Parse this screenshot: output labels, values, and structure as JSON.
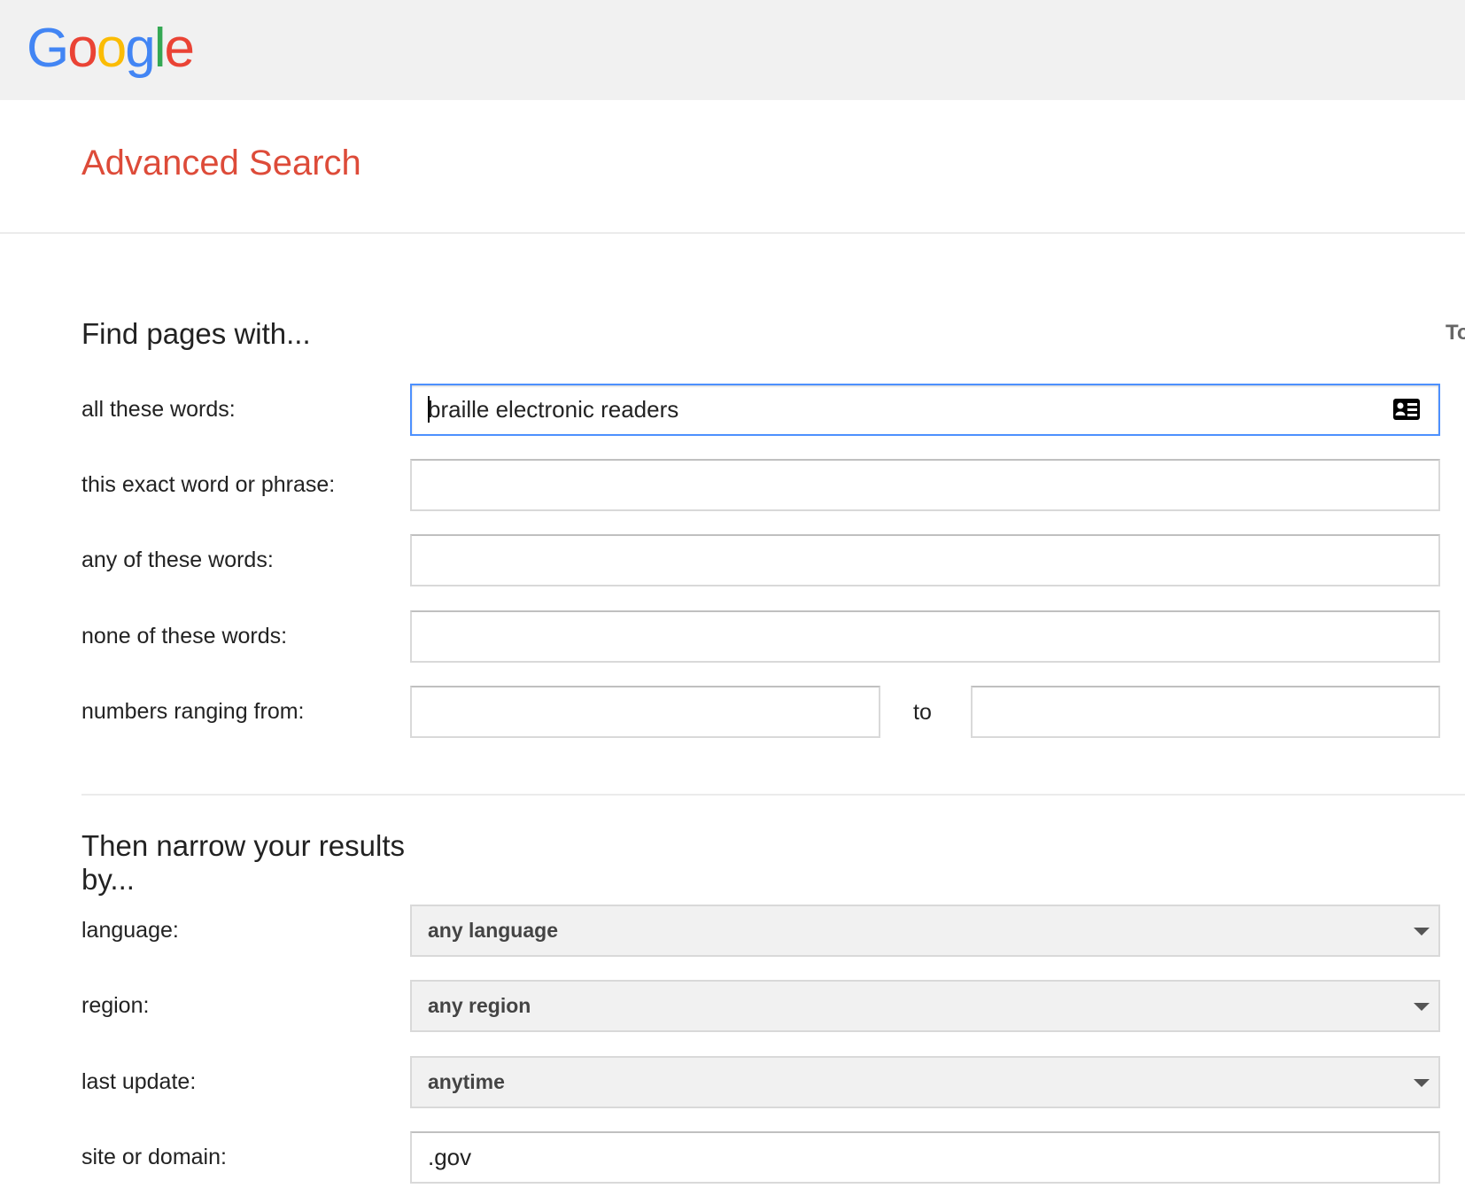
{
  "header": {
    "logo_letters": [
      {
        "char": "G",
        "color": "#4285f4"
      },
      {
        "char": "o",
        "color": "#ea4335"
      },
      {
        "char": "o",
        "color": "#fbbc05"
      },
      {
        "char": "g",
        "color": "#4285f4"
      },
      {
        "char": "l",
        "color": "#34a853"
      },
      {
        "char": "e",
        "color": "#ea4335"
      }
    ]
  },
  "page": {
    "title": "Advanced Search",
    "right_cut_text": "To"
  },
  "find_section": {
    "heading": "Find pages with...",
    "all_words": {
      "label": "all these words:",
      "value": "braille electronic readers"
    },
    "exact_phrase": {
      "label": "this exact word or phrase:",
      "value": ""
    },
    "any_words": {
      "label": "any of these words:",
      "value": ""
    },
    "none_words": {
      "label": "none of these words:",
      "value": ""
    },
    "numbers": {
      "label": "numbers ranging from:",
      "from_value": "",
      "to_label": "to",
      "to_value": ""
    }
  },
  "narrow_section": {
    "heading_line1": "Then narrow your results",
    "heading_line2": "by...",
    "language": {
      "label": "language:",
      "value": "any language"
    },
    "region": {
      "label": "region:",
      "value": "any region"
    },
    "last_update": {
      "label": "last update:",
      "value": "anytime"
    },
    "site_domain": {
      "label": "site or domain:",
      "value": ".gov"
    }
  },
  "colors": {
    "title_red": "#dd4b39",
    "focus_blue": "#4d90fe",
    "topbar_gray": "#f1f1f1"
  }
}
